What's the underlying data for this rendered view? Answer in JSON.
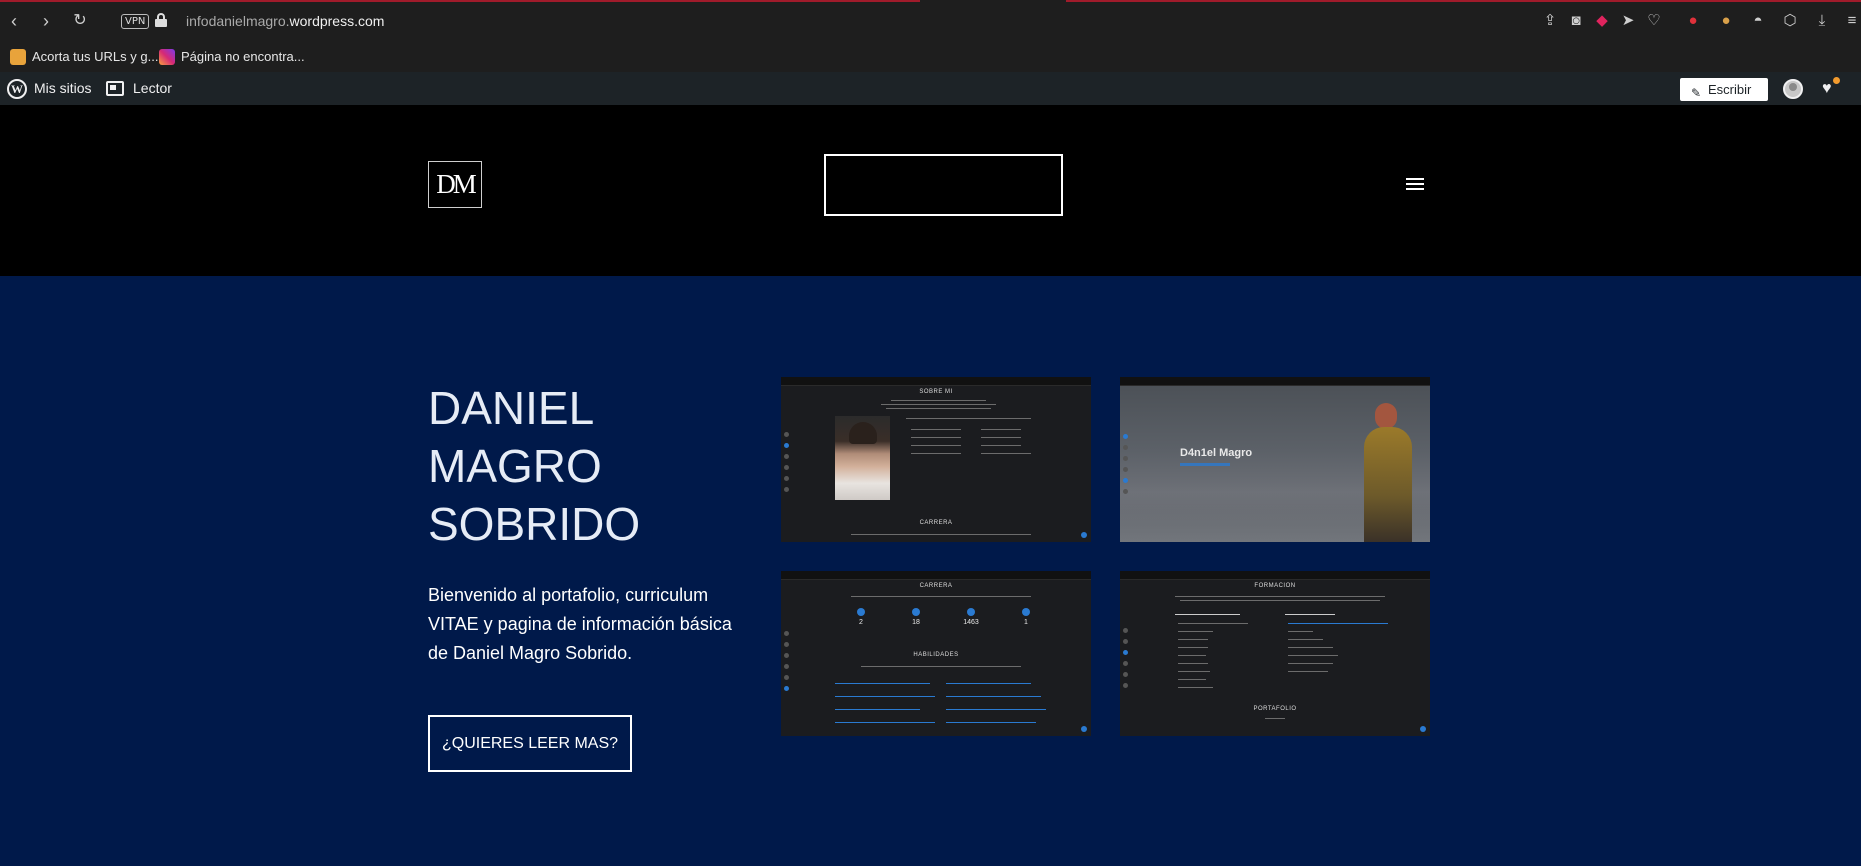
{
  "browser": {
    "vpn_label": "VPN",
    "url_prefix": "infodanielmagro.",
    "url_domain": "wordpress.com",
    "bookmarks": [
      {
        "label": "Acorta tus URLs y g...",
        "color": "#e8a33b"
      },
      {
        "label": "Página no encontra...",
        "color": "#d62976"
      }
    ]
  },
  "wp_admin": {
    "my_sites": "Mis sitios",
    "reader": "Lector",
    "write": "Escribir"
  },
  "site": {
    "logo_text": "DM",
    "hero_title": "DANIEL MAGRO SOBRIDO",
    "hero_text": "Bienvenido al portafolio, curriculum VITAE y pagina de información básica de Daniel Magro Sobrido.",
    "cta_label": "¿QUIERES LEER MAS?"
  },
  "thumbnails": {
    "t1_heading": "SOBRE MI",
    "t1_footer": "CARRERA",
    "t2_name": "D4n1el Magro",
    "t3_heading": "CARRERA",
    "t3_stats": [
      "2",
      "18",
      "1463",
      "1"
    ],
    "t3_sub": "HABILIDADES",
    "t4_heading": "FORMACION",
    "t4_footer": "PORTAFOLIO"
  },
  "colors": {
    "hero_bg": "#00194a",
    "header_bg": "#000000",
    "accent": "#2a7ad1"
  }
}
